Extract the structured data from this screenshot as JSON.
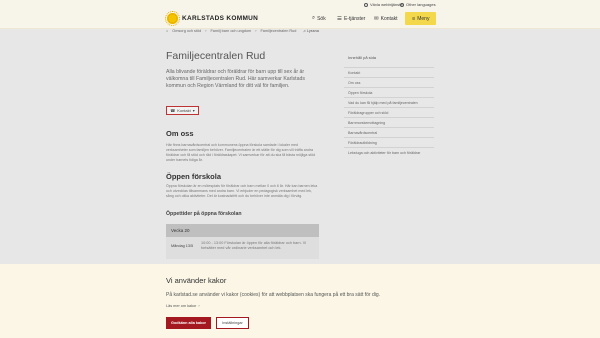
{
  "utility": {
    "vaxla": "Växla webbtjänster",
    "language": "Other languages"
  },
  "header": {
    "logo_text": "KARLSTADS KOMMUN",
    "search": "Sök",
    "e_services": "E-tjänster",
    "contact": "Kontakt",
    "menu": "Meny"
  },
  "breadcrumb": [
    "Omsorg och stöd",
    "Familj barn och ungdom",
    "Familjecentralen Rud"
  ],
  "listen": "Lyssna",
  "title": "Familjecentralen Rud",
  "lead": "Alla blivande föräldrar och föräldrar för barn upp till sex år är välkomna till Familjecentralen Rud. Här samverkar Karlstads kommun och Region Värmland för ditt väl för familjen.",
  "contact_button": "Kontakt",
  "about": {
    "heading": "Om oss",
    "text": "Här finns barnavårdscentral och kommunens öppna förskola samlade i lokaler med verksamheter som familjen behöver. Familjecentralen är ett ställe för dig som vill träffa andra föräldrar och få stöd och råd i föräldraskapet. Vi samverkar för att du ska få bästa möjliga stöd under barnets tidiga år."
  },
  "preschool": {
    "heading": "Öppen förskola",
    "text": "Öppna förskolan är en mötesplats för föräldrar och barn mellan 0 och 6 år. Här kan barnen leka och utvecklas tillsammans med andra barn. Vi erbjuder en pedagogisk verksamhet med lek, sång och olika aktiviteter. Det är kostnadsfritt och du behöver inte anmäla dig i förväg."
  },
  "hours": {
    "heading": "Öppettider på öppna förskolan",
    "week": "Vecka 20",
    "day": "Måndag 13/5",
    "text": "10:00 - 13:00 Förskolan är öppen för alla föräldrar och barn. Vi fortsätter med vår ordinarie verksamhet och lek."
  },
  "sidebar": {
    "title": "Innehåll på sida",
    "items": [
      "Kontakt",
      "Om oss",
      "Öppen förskola",
      "Vad du kan få hjälp med på familjecentralen",
      "Föräldragrupper och stöd",
      "Barnmorskemottagning",
      "Barnavårdscentral",
      "Föräldrautbildning",
      "Lekstuga och aktiviteter för barn och föräldrar"
    ]
  },
  "cookie": {
    "title": "Vi använder kakor",
    "text": "På karlstad.se använder vi kakor (cookies) för att webbplatsen ska fungera på ett bra sätt för dig.",
    "link": "Läs mer om kakor",
    "accept": "Godkänn alla kakor",
    "settings": "Inställningar"
  }
}
